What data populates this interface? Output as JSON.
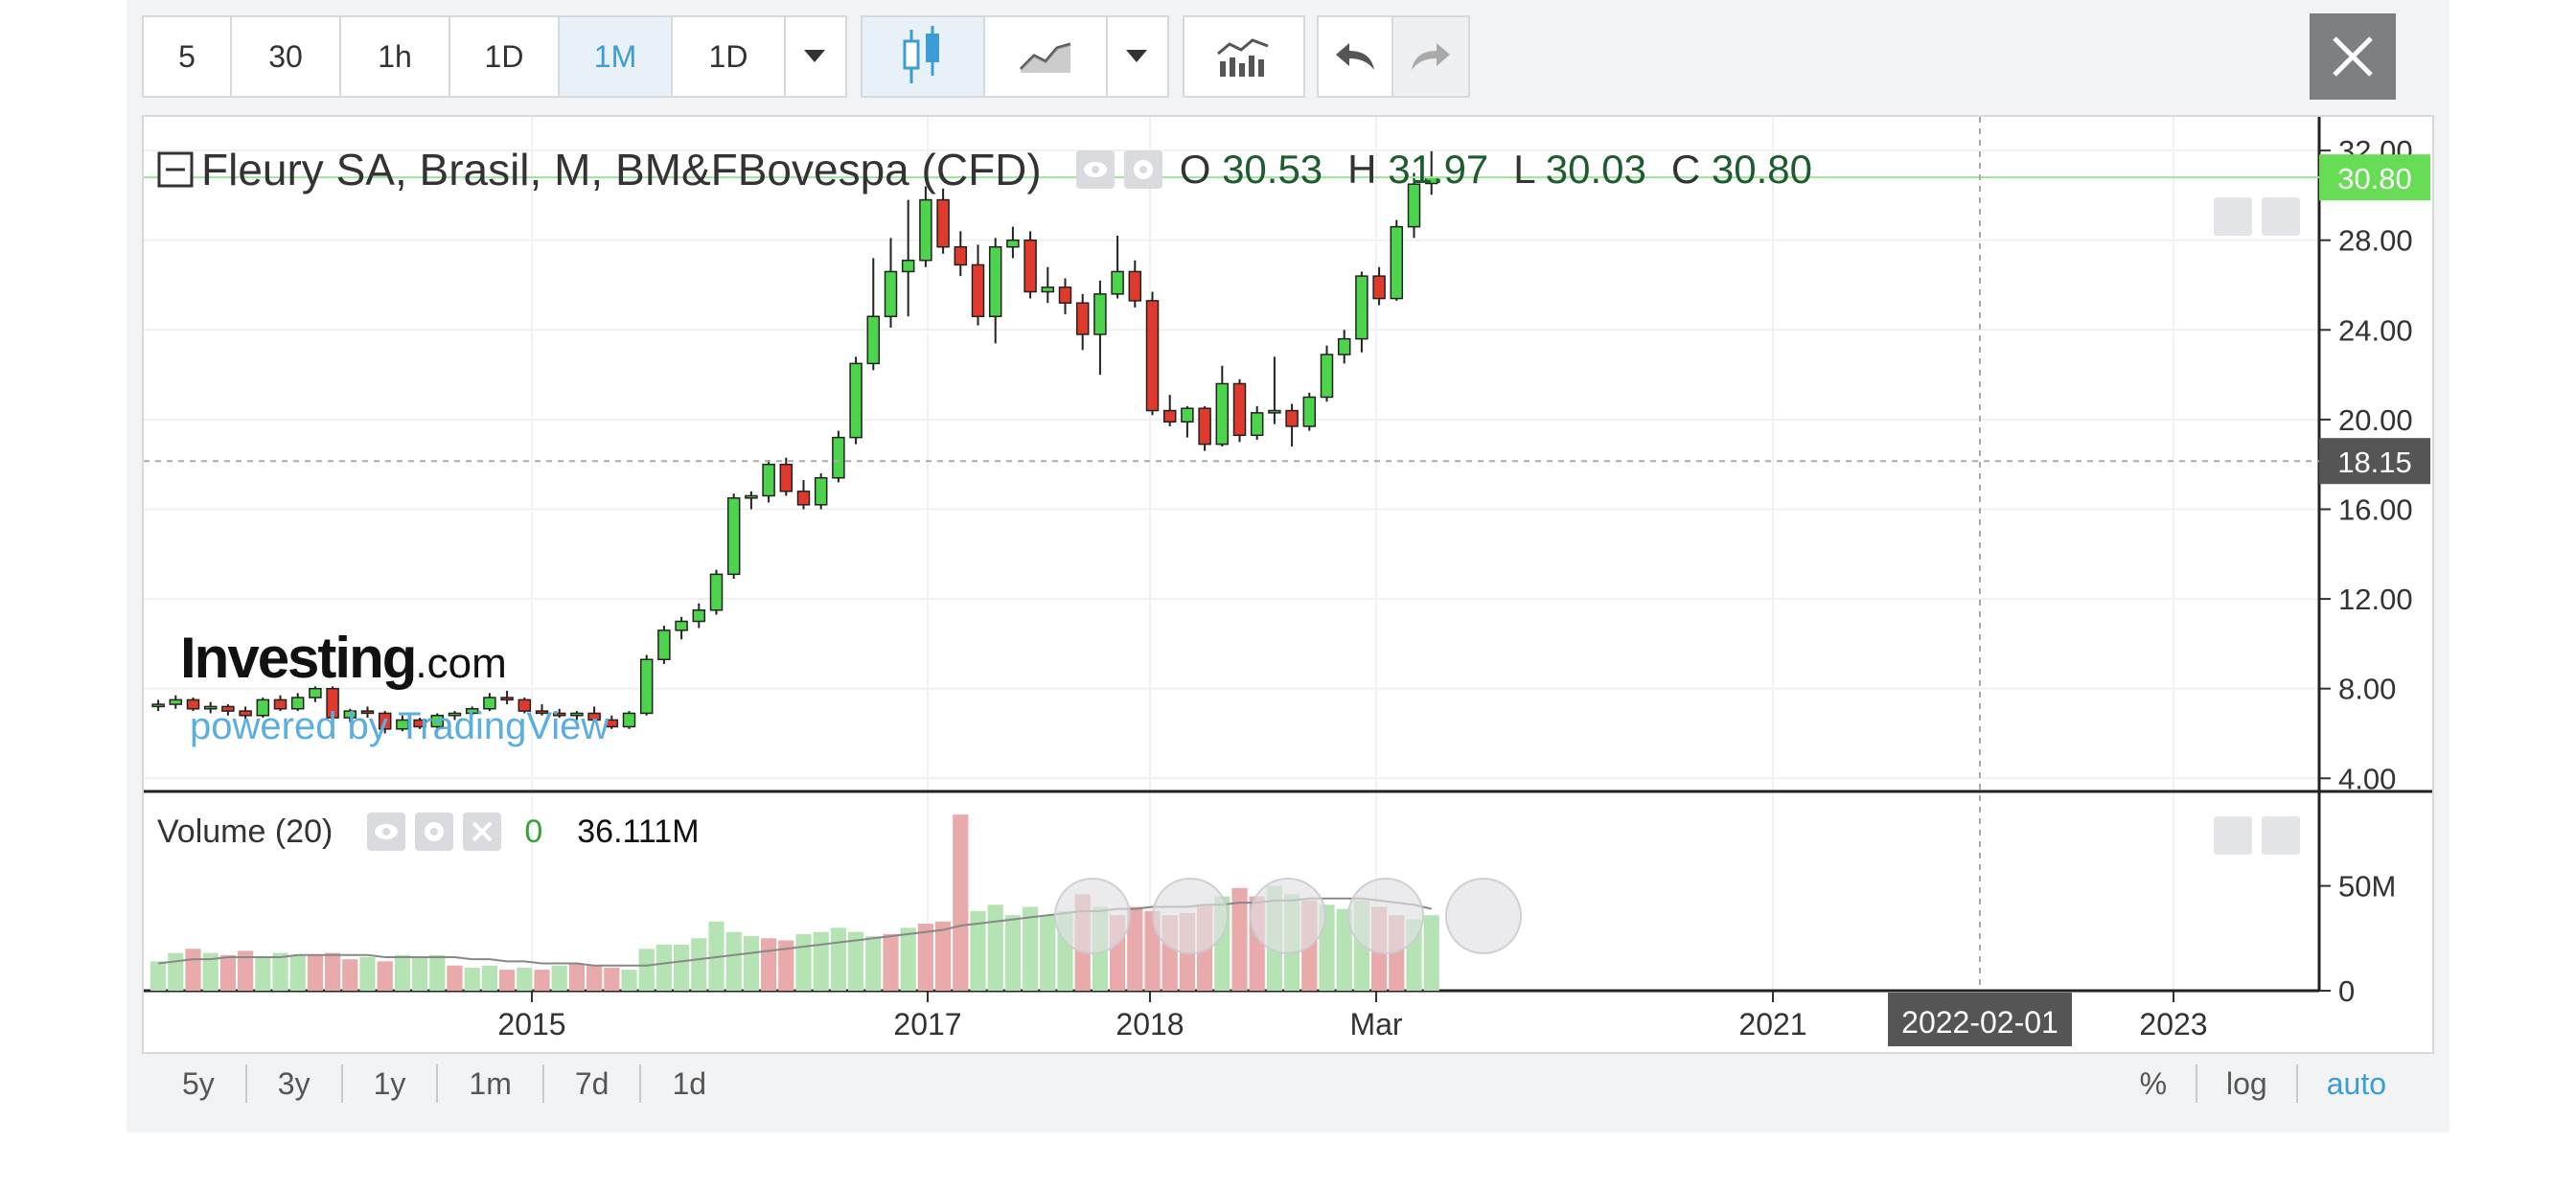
{
  "toolbar": {
    "intervals": [
      "5",
      "30",
      "1h",
      "1D",
      "1M",
      "1D"
    ],
    "active_interval": "1M"
  },
  "legend": {
    "title": "Fleury SA, Brasil, M, BM&FBovespa (CFD)",
    "open_label": "O",
    "open": "30.53",
    "high_label": "H",
    "high": "31.97",
    "low_label": "L",
    "low": "30.03",
    "close_label": "C",
    "close": "30.80"
  },
  "volume_legend": {
    "title": "Volume (20)",
    "value1": "0",
    "value2": "36.111M"
  },
  "price_labels": {
    "last": "30.80",
    "crosshair": "18.15"
  },
  "date_label": "2022-02-01",
  "watermark": {
    "brand": "Investing",
    "brand_suffix": ".com",
    "powered": "powered by TradingView"
  },
  "range_buttons": [
    "5y",
    "3y",
    "1y",
    "1m",
    "7d",
    "1d"
  ],
  "scale_buttons": [
    "%",
    "log",
    "auto"
  ],
  "colors": {
    "up": "#4cd44c",
    "down": "#e03a2c",
    "vol_up": "#b6e3b3",
    "vol_down": "#e8aaaa",
    "accent": "#3b9cd6",
    "last_price": "#66dd55"
  },
  "chart_data": {
    "type": "candlestick",
    "price_axis": {
      "ticks": [
        "4.00",
        "8.00",
        "12.00",
        "16.00",
        "20.00",
        "24.00",
        "28.00",
        "32.00"
      ],
      "ylim": [
        3.5,
        33.5
      ]
    },
    "volume_axis": {
      "ticks": [
        "0",
        "50M"
      ],
      "ylim": [
        0,
        85
      ]
    },
    "x_ticks": [
      "2015",
      "2017",
      "2018",
      "Mar",
      "2021",
      "2023"
    ],
    "candles": [
      [
        7.2,
        7.5,
        7.0,
        7.3
      ],
      [
        7.3,
        7.7,
        7.1,
        7.5
      ],
      [
        7.5,
        7.6,
        7.0,
        7.1
      ],
      [
        7.1,
        7.4,
        6.9,
        7.2
      ],
      [
        7.2,
        7.3,
        6.8,
        7.0
      ],
      [
        7.0,
        7.2,
        6.6,
        6.8
      ],
      [
        6.8,
        7.6,
        6.7,
        7.5
      ],
      [
        7.5,
        7.7,
        7.0,
        7.1
      ],
      [
        7.1,
        7.8,
        7.0,
        7.6
      ],
      [
        7.6,
        8.1,
        7.4,
        8.0
      ],
      [
        8.0,
        8.1,
        6.6,
        6.7
      ],
      [
        6.7,
        7.1,
        6.5,
        7.0
      ],
      [
        7.0,
        7.2,
        6.7,
        6.9
      ],
      [
        6.9,
        7.0,
        6.0,
        6.2
      ],
      [
        6.2,
        6.8,
        6.1,
        6.6
      ],
      [
        6.6,
        6.7,
        6.2,
        6.3
      ],
      [
        6.3,
        6.9,
        6.2,
        6.8
      ],
      [
        6.8,
        7.0,
        6.6,
        6.9
      ],
      [
        6.9,
        7.2,
        6.8,
        7.1
      ],
      [
        7.1,
        7.8,
        7.0,
        7.6
      ],
      [
        7.6,
        7.9,
        7.3,
        7.5
      ],
      [
        7.5,
        7.6,
        6.9,
        7.0
      ],
      [
        7.0,
        7.3,
        6.8,
        6.9
      ],
      [
        6.9,
        7.1,
        6.7,
        6.8
      ],
      [
        6.8,
        7.0,
        6.6,
        6.9
      ],
      [
        6.9,
        7.2,
        6.5,
        6.6
      ],
      [
        6.6,
        6.8,
        6.2,
        6.3
      ],
      [
        6.3,
        7.0,
        6.2,
        6.9
      ],
      [
        6.9,
        9.5,
        6.8,
        9.3
      ],
      [
        9.3,
        10.8,
        9.1,
        10.6
      ],
      [
        10.6,
        11.2,
        10.2,
        11.0
      ],
      [
        11.0,
        11.8,
        10.7,
        11.5
      ],
      [
        11.5,
        13.3,
        11.3,
        13.1
      ],
      [
        13.1,
        16.7,
        12.9,
        16.5
      ],
      [
        16.5,
        16.8,
        16.0,
        16.6
      ],
      [
        16.6,
        18.2,
        16.3,
        18.0
      ],
      [
        18.0,
        18.3,
        16.6,
        16.8
      ],
      [
        16.8,
        17.3,
        16.0,
        16.2
      ],
      [
        16.2,
        17.6,
        16.0,
        17.4
      ],
      [
        17.4,
        19.5,
        17.2,
        19.2
      ],
      [
        19.2,
        22.8,
        18.9,
        22.5
      ],
      [
        22.5,
        27.2,
        22.2,
        24.6
      ],
      [
        24.6,
        28.1,
        24.1,
        26.6
      ],
      [
        26.6,
        29.8,
        24.6,
        27.1
      ],
      [
        27.1,
        30.4,
        26.8,
        29.8
      ],
      [
        29.8,
        30.3,
        27.4,
        27.7
      ],
      [
        27.7,
        28.4,
        26.4,
        26.9
      ],
      [
        26.9,
        27.8,
        24.2,
        24.6
      ],
      [
        24.6,
        28.1,
        23.4,
        27.7
      ],
      [
        27.7,
        28.6,
        27.2,
        28.0
      ],
      [
        28.0,
        28.4,
        25.4,
        25.7
      ],
      [
        25.7,
        26.8,
        25.2,
        25.9
      ],
      [
        25.9,
        26.3,
        24.7,
        25.2
      ],
      [
        25.2,
        25.6,
        23.1,
        23.8
      ],
      [
        23.8,
        26.2,
        22.0,
        25.6
      ],
      [
        25.6,
        28.2,
        25.4,
        26.6
      ],
      [
        26.6,
        27.1,
        25.0,
        25.3
      ],
      [
        25.3,
        25.7,
        20.2,
        20.4
      ],
      [
        20.4,
        21.1,
        19.7,
        19.9
      ],
      [
        19.9,
        20.6,
        19.2,
        20.5
      ],
      [
        20.5,
        20.6,
        18.6,
        18.9
      ],
      [
        18.9,
        22.4,
        18.8,
        21.6
      ],
      [
        21.6,
        21.8,
        19.0,
        19.3
      ],
      [
        19.3,
        20.6,
        19.1,
        20.3
      ],
      [
        20.3,
        22.8,
        19.8,
        20.4
      ],
      [
        20.4,
        20.7,
        18.8,
        19.7
      ],
      [
        19.7,
        21.2,
        19.5,
        21.0
      ],
      [
        21.0,
        23.3,
        20.8,
        22.9
      ],
      [
        22.9,
        24.0,
        22.5,
        23.6
      ],
      [
        23.6,
        26.6,
        23.0,
        26.4
      ],
      [
        26.4,
        26.8,
        25.1,
        25.4
      ],
      [
        25.4,
        28.9,
        25.3,
        28.6
      ],
      [
        28.6,
        31.0,
        28.1,
        30.5
      ],
      [
        30.53,
        31.97,
        30.03,
        30.8
      ]
    ],
    "volumes": [
      [
        14,
        1
      ],
      [
        18,
        1
      ],
      [
        20,
        0
      ],
      [
        18,
        1
      ],
      [
        17,
        0
      ],
      [
        19,
        0
      ],
      [
        16,
        1
      ],
      [
        18,
        1
      ],
      [
        17,
        1
      ],
      [
        17,
        0
      ],
      [
        18,
        0
      ],
      [
        15,
        0
      ],
      [
        16,
        1
      ],
      [
        14,
        0
      ],
      [
        17,
        1
      ],
      [
        16,
        1
      ],
      [
        17,
        1
      ],
      [
        12,
        0
      ],
      [
        11,
        1
      ],
      [
        12,
        1
      ],
      [
        10,
        0
      ],
      [
        11,
        1
      ],
      [
        10,
        0
      ],
      [
        12,
        1
      ],
      [
        13,
        0
      ],
      [
        12,
        0
      ],
      [
        11,
        0
      ],
      [
        10,
        1
      ],
      [
        20,
        1
      ],
      [
        22,
        1
      ],
      [
        22,
        1
      ],
      [
        25,
        1
      ],
      [
        33,
        1
      ],
      [
        28,
        1
      ],
      [
        26,
        1
      ],
      [
        25,
        0
      ],
      [
        24,
        0
      ],
      [
        27,
        1
      ],
      [
        28,
        1
      ],
      [
        30,
        1
      ],
      [
        28,
        1
      ],
      [
        26,
        1
      ],
      [
        27,
        0
      ],
      [
        30,
        1
      ],
      [
        32,
        0
      ],
      [
        33,
        0
      ],
      [
        84,
        0
      ],
      [
        38,
        1
      ],
      [
        41,
        1
      ],
      [
        36,
        1
      ],
      [
        40,
        1
      ],
      [
        36,
        1
      ],
      [
        38,
        1
      ],
      [
        46,
        0
      ],
      [
        40,
        1
      ],
      [
        36,
        0
      ],
      [
        40,
        0
      ],
      [
        38,
        0
      ],
      [
        36,
        0
      ],
      [
        37,
        0
      ],
      [
        41,
        0
      ],
      [
        45,
        1
      ],
      [
        49,
        0
      ],
      [
        45,
        0
      ],
      [
        50,
        1
      ],
      [
        46,
        1
      ],
      [
        43,
        0
      ],
      [
        41,
        1
      ],
      [
        39,
        1
      ],
      [
        43,
        1
      ],
      [
        40,
        0
      ],
      [
        36,
        0
      ],
      [
        34,
        1
      ],
      [
        36,
        1
      ]
    ],
    "volume_ma": [
      13,
      14,
      15,
      15,
      16,
      16,
      16,
      16,
      17,
      17,
      17,
      17,
      17,
      16,
      16,
      16,
      16,
      16,
      15,
      15,
      14,
      14,
      13,
      13,
      13,
      12,
      12,
      12,
      12,
      13,
      14,
      15,
      16,
      17,
      18,
      19,
      20,
      21,
      22,
      23,
      24,
      25,
      26,
      27,
      28,
      29,
      31,
      32,
      33,
      34,
      35,
      36,
      37,
      38,
      38,
      39,
      39,
      40,
      40,
      40,
      41,
      41,
      42,
      42,
      43,
      43,
      44,
      44,
      44,
      44,
      43,
      42,
      41,
      39
    ]
  }
}
